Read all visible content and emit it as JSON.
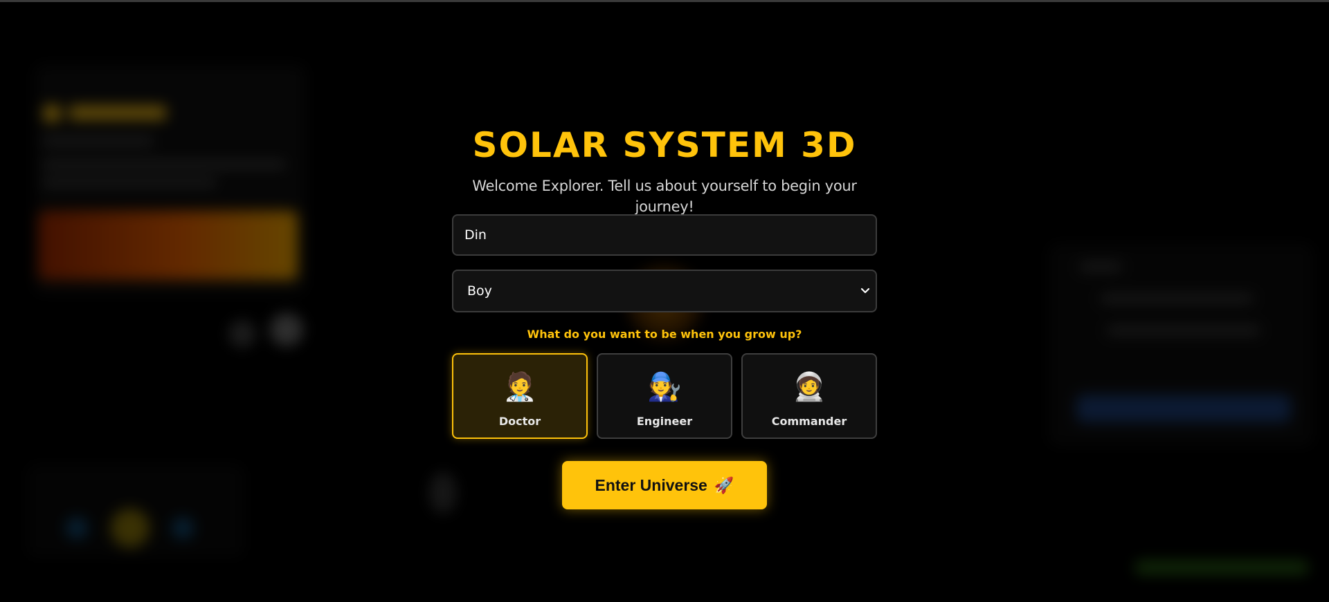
{
  "app": {
    "title": "SOLAR SYSTEM 3D",
    "subtitle": "Welcome Explorer. Tell us about yourself to begin your journey!"
  },
  "form": {
    "name_value": "Din",
    "gender_selected": "Boy",
    "question": "What do you want to be when you grow up?",
    "careers": [
      {
        "label": "Doctor",
        "emoji": "🧑‍⚕️",
        "selected": true
      },
      {
        "label": "Engineer",
        "emoji": "🧑‍🔧",
        "selected": false
      },
      {
        "label": "Commander",
        "emoji": "🧑‍🚀",
        "selected": false
      }
    ],
    "submit_label": "Enter Universe",
    "submit_icon": "🚀"
  },
  "colors": {
    "accent": "#ffc30b",
    "background": "#000000",
    "field_bg": "#121212"
  }
}
